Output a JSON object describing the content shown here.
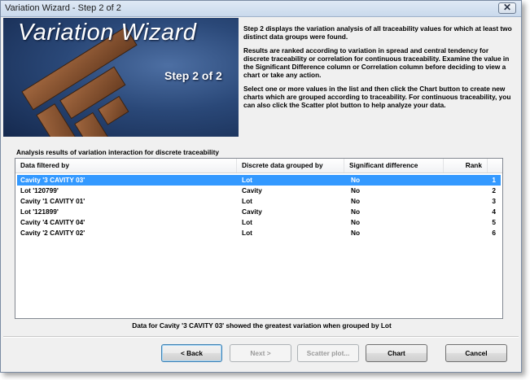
{
  "window": {
    "title": "Variation Wizard - Step 2 of 2",
    "close_glyph": "✕"
  },
  "banner": {
    "title": "Variation Wizard",
    "step": "Step 2 of 2"
  },
  "description": {
    "p1": "Step 2 displays the variation analysis of all traceability values for which at least two distinct data groups were found.",
    "p2": "Results are ranked according to variation in spread and central tendency for discrete traceability or correlation for continuous traceability. Examine the value in the Significant Difference column or Correlation column before deciding to view a chart or take any action.",
    "p3": "Select one or more values in the list and then click the  Chart button to create new charts which are grouped according to traceability.  For continuous traceability, you can also click the Scatter plot button to help analyze your data."
  },
  "results": {
    "label": "Analysis results of variation interaction for discrete traceability",
    "columns": [
      "Data filtered by",
      "Discrete data grouped by",
      "Significant difference",
      "Rank"
    ],
    "rows": [
      {
        "filtered": "Cavity '3 CAVITY 03'",
        "grouped": "Lot",
        "significant": "No",
        "rank": "1",
        "selected": true
      },
      {
        "filtered": "Lot '120799'",
        "grouped": "Cavity",
        "significant": "No",
        "rank": "2",
        "selected": false
      },
      {
        "filtered": "Cavity '1 CAVITY 01'",
        "grouped": "Lot",
        "significant": "No",
        "rank": "3",
        "selected": false
      },
      {
        "filtered": "Lot '121899'",
        "grouped": "Cavity",
        "significant": "No",
        "rank": "4",
        "selected": false
      },
      {
        "filtered": "Cavity '4 CAVITY 04'",
        "grouped": "Lot",
        "significant": "No",
        "rank": "5",
        "selected": false
      },
      {
        "filtered": "Cavity '2 CAVITY 02'",
        "grouped": "Lot",
        "significant": "No",
        "rank": "6",
        "selected": false
      }
    ]
  },
  "status_text": "Data for Cavity '3 CAVITY 03' showed the greatest variation when grouped by Lot",
  "buttons": {
    "back": "< Back",
    "next": "Next >",
    "scatter": "Scatter plot...",
    "chart": "Chart",
    "cancel": "Cancel"
  },
  "colors": {
    "selection": "#3399ff",
    "banner_blue": "#2a4878",
    "logo_brown": "#7a4a2a"
  }
}
